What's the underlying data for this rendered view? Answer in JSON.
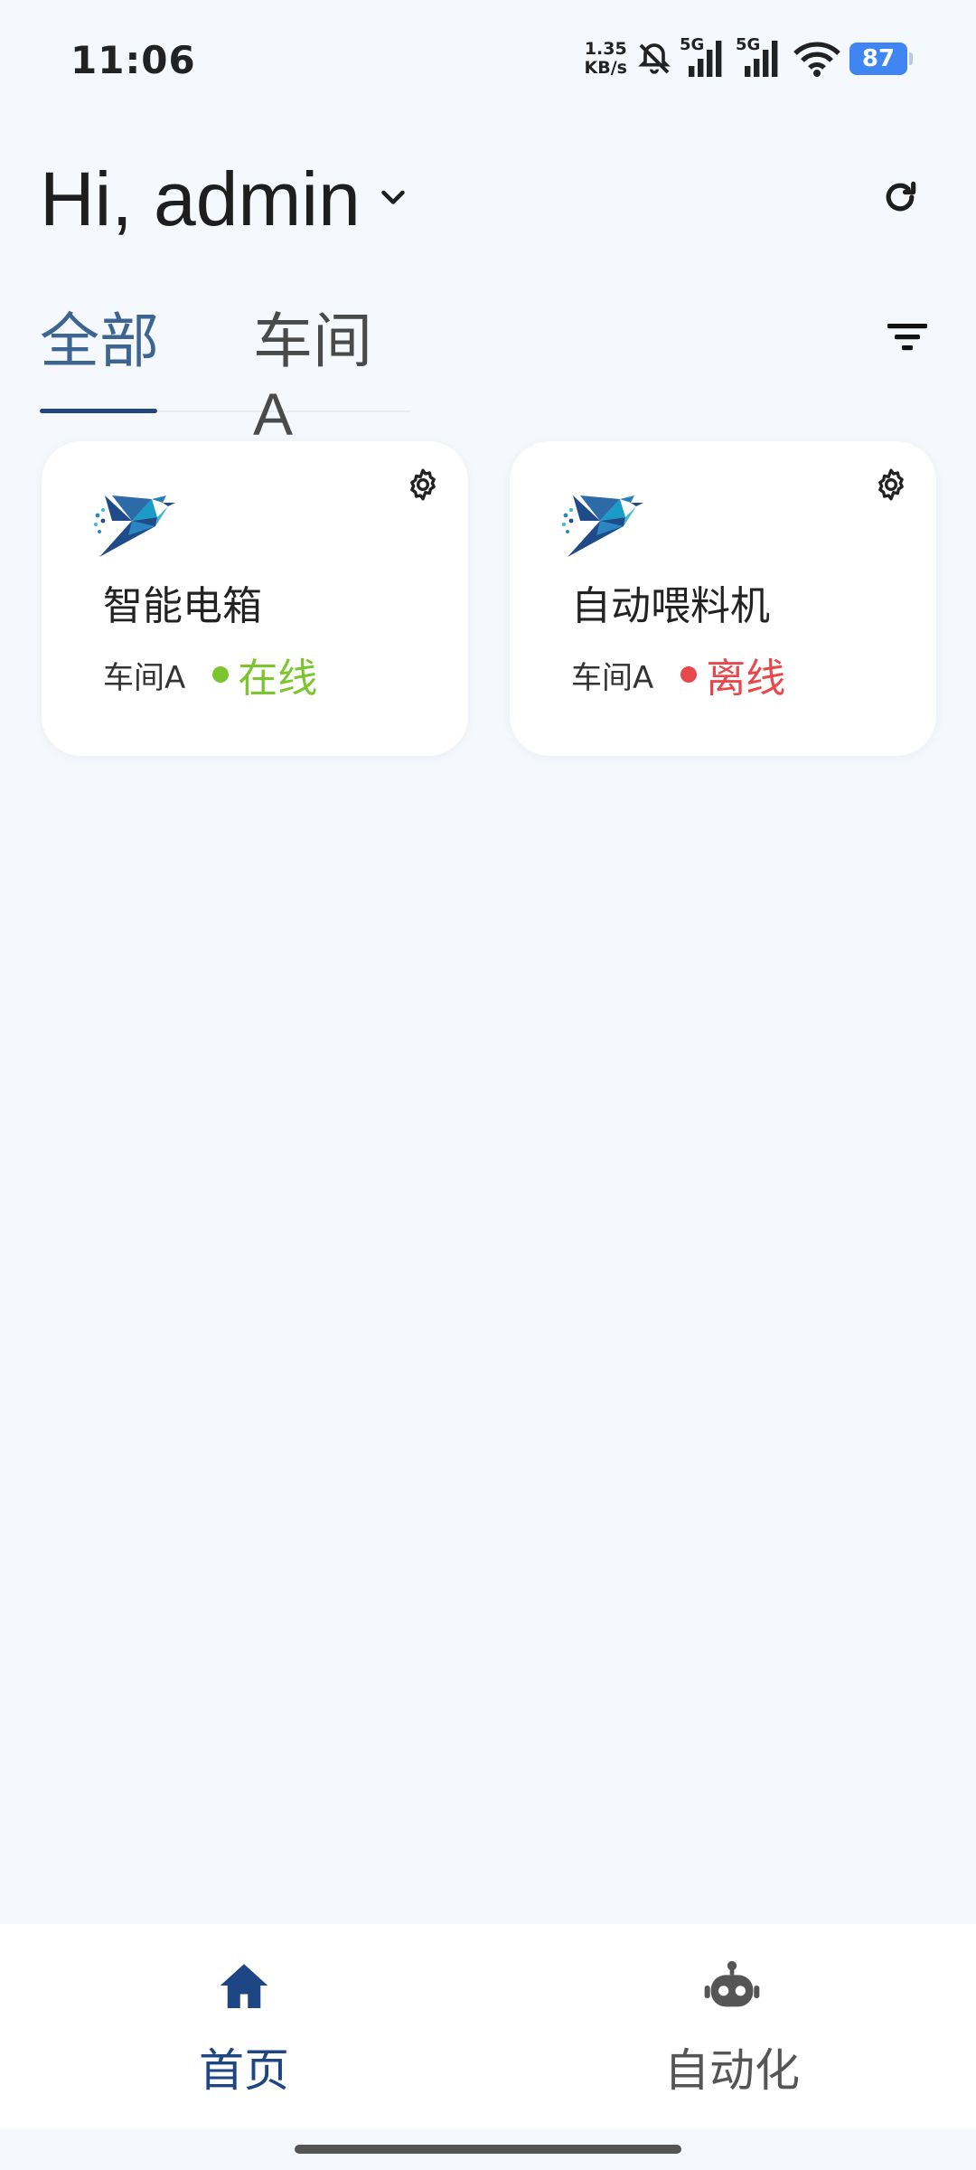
{
  "status_bar": {
    "time": "11:06",
    "net_speed_value": "1.35",
    "net_speed_unit": "KB/s",
    "signal_1_label": "5G",
    "signal_2_label": "5G",
    "battery_level": "87",
    "icons": [
      "mute-icon",
      "signal-icon",
      "signal-icon",
      "wifi-icon",
      "battery-icon"
    ]
  },
  "header": {
    "greeting": "Hi, admin",
    "dropdown_icon": "chevron-down-icon",
    "refresh_icon": "refresh-icon"
  },
  "tabs": [
    {
      "label": "全部",
      "active": true
    },
    {
      "label": "车间A",
      "active": false
    }
  ],
  "filter_icon": "filter-icon",
  "devices": [
    {
      "name": "智能电箱",
      "room": "车间A",
      "status": "在线",
      "status_color": "#7BC52E",
      "settings_icon": "gear-icon",
      "logo": "bird-logo"
    },
    {
      "name": "自动喂料机",
      "room": "车间A",
      "status": "离线",
      "status_color": "#E8474C",
      "settings_icon": "gear-icon",
      "logo": "bird-logo"
    }
  ],
  "bottom_nav": [
    {
      "label": "首页",
      "icon": "home-icon",
      "active": true,
      "color": "#1E4584"
    },
    {
      "label": "自动化",
      "icon": "robot-icon",
      "active": false,
      "color": "#555555"
    }
  ]
}
